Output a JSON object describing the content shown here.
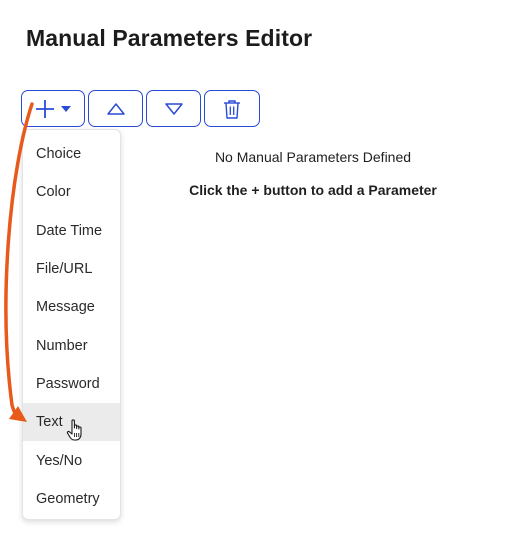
{
  "page": {
    "title": "Manual Parameters Editor"
  },
  "toolbar": {
    "add_icon": "plus-icon",
    "dropdown_icon": "caret-down-icon",
    "move_up_icon": "triangle-up-icon",
    "move_down_icon": "triangle-down-icon",
    "delete_icon": "trash-icon"
  },
  "empty_state": {
    "message": "No Manual Parameters Defined",
    "hint": "Click the + button to add a Parameter"
  },
  "menu": {
    "items": [
      {
        "label": "Choice"
      },
      {
        "label": "Color"
      },
      {
        "label": "Date Time"
      },
      {
        "label": "File/URL"
      },
      {
        "label": "Message"
      },
      {
        "label": "Number"
      },
      {
        "label": "Password"
      },
      {
        "label": "Text",
        "hovered": true
      },
      {
        "label": "Yes/No"
      },
      {
        "label": "Geometry"
      }
    ]
  },
  "colors": {
    "accent": "#2a4bd6",
    "annotation_arrow": "#e85a1c",
    "hover_bg": "#ebebeb"
  }
}
